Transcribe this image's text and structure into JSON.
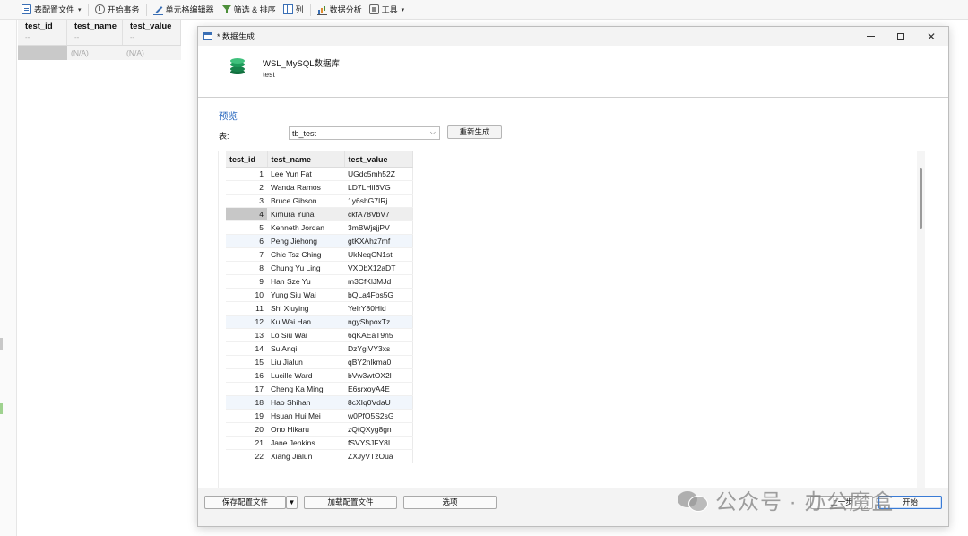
{
  "toolbar": {
    "items": [
      {
        "label": "表配置文件",
        "icon": "document-icon",
        "dropdown": true
      },
      {
        "label": "开始事务",
        "icon": "transaction-icon",
        "dropdown": false
      },
      {
        "label": "单元格编辑器",
        "icon": "edit-icon",
        "dropdown": false
      },
      {
        "label": "筛选 & 排序",
        "icon": "filter-icon",
        "dropdown": false
      },
      {
        "label": "列",
        "icon": "columns-icon",
        "dropdown": false
      },
      {
        "label": "数据分析",
        "icon": "chart-icon",
        "dropdown": false
      },
      {
        "label": "工具",
        "icon": "tools-icon",
        "dropdown": true
      }
    ]
  },
  "background_grid": {
    "columns": [
      {
        "name": "test_id",
        "sub": "--"
      },
      {
        "name": "test_name",
        "sub": "--"
      },
      {
        "name": "test_value",
        "sub": "--"
      }
    ],
    "row": [
      "",
      "(N/A)",
      "(N/A)"
    ]
  },
  "dialog": {
    "title": "* 数据生成",
    "connection_name": "WSL_MySQL数据库",
    "database_name": "test",
    "preview_label": "预览",
    "table_label": "表:",
    "table_value": "tb_test",
    "regenerate_label": "重新生成",
    "columns": [
      "test_id",
      "test_name",
      "test_value"
    ],
    "rows": [
      [
        "1",
        "Lee Yun Fat",
        "UGdc5mh52Z"
      ],
      [
        "2",
        "Wanda Ramos",
        "LD7LHiI6VG"
      ],
      [
        "3",
        "Bruce Gibson",
        "1y6shG7IRj"
      ],
      [
        "4",
        "Kimura Yuna",
        "ckfA78VbV7"
      ],
      [
        "5",
        "Kenneth Jordan",
        "3mBWjsjjPV"
      ],
      [
        "6",
        "Peng Jiehong",
        "gtKXAhz7mf"
      ],
      [
        "7",
        "Chic Tsz Ching",
        "UkNeqCN1st"
      ],
      [
        "8",
        "Chung Yu Ling",
        "VXDbX12aDT"
      ],
      [
        "9",
        "Han Sze Yu",
        "m3CfKlJMJd"
      ],
      [
        "10",
        "Yung Siu Wai",
        "bQLa4Fbs5G"
      ],
      [
        "11",
        "Shi Xiuying",
        "YeIrY80Hid"
      ],
      [
        "12",
        "Ku Wai Han",
        "ngyShpoxTz"
      ],
      [
        "13",
        "Lo Siu Wai",
        "6qKAEaT9n5"
      ],
      [
        "14",
        "Su Anqi",
        "DzYgiVY3xs"
      ],
      [
        "15",
        "Liu Jialun",
        "qBY2nlkma0"
      ],
      [
        "16",
        "Lucille Ward",
        "bVw3wtOX2l"
      ],
      [
        "17",
        "Cheng Ka Ming",
        "E6srxoyA4E"
      ],
      [
        "18",
        "Hao Shihan",
        "8cXIq0VdaU"
      ],
      [
        "19",
        "Hsuan Hui Mei",
        "w0PfO5S2sG"
      ],
      [
        "20",
        "Ono Hikaru",
        "zQtQXyg8gn"
      ],
      [
        "21",
        "Jane Jenkins",
        "fSVYSJFY8I"
      ],
      [
        "22",
        "Xiang Jialun",
        "ZXJyVTzOua"
      ]
    ],
    "highlighted_row": 3,
    "footer": {
      "save_profile": "保存配置文件",
      "load_profile": "加载配置文件",
      "options": "选项",
      "back": "上一步",
      "start": "开始"
    }
  },
  "watermark": "公众号 · 办公魔盒"
}
